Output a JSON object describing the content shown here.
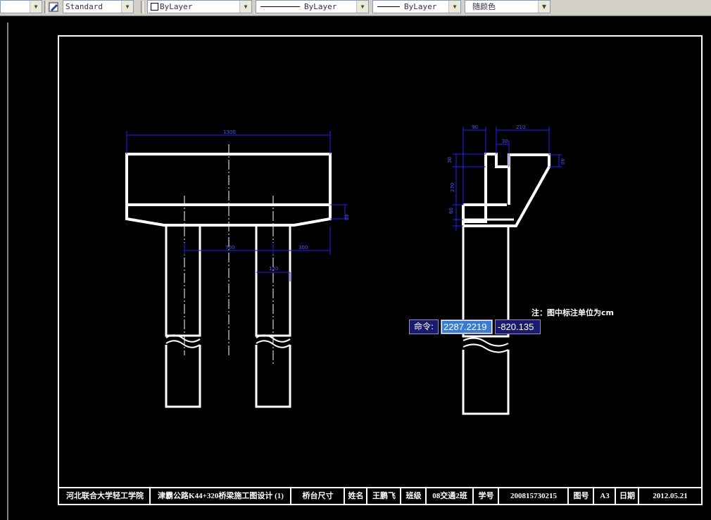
{
  "toolbar": {
    "textstyle_value": "Standard",
    "layer_value": "ByLayer",
    "linetype_value": "ByLayer",
    "lineweight_value": "ByLayer",
    "color_value": "随颜色"
  },
  "dimensions": {
    "front_width": "1300",
    "front_right_height": "40",
    "front_pile_spacing": "700",
    "front_right_offset": "300",
    "front_pile_diameter": "120",
    "side_top_left": "90",
    "side_top_right": "210",
    "side_inner": "30",
    "side_d1": "30",
    "side_d2": "270",
    "side_d3": "60",
    "side_d4": "40"
  },
  "note_text": "注：图中标注单位为cm",
  "command": {
    "label": "命令:",
    "x_value": "2287.2219",
    "y_value": "-820.135"
  },
  "title_block": {
    "school": "河北联合大学轻工学院",
    "project": "津霸公路K44+320桥梁施工图设计 (1)",
    "drawing_name": "桥台尺寸",
    "name_label": "姓名",
    "name_value": "王鹏飞",
    "class_label": "班级",
    "class_value": "08交通2班",
    "id_label": "学号",
    "id_value": "200815730215",
    "sheet_label": "图号",
    "sheet_value": "A3",
    "date_label": "日期",
    "date_value": "2012.05.21"
  },
  "colors": {
    "drawing": "#ffffff",
    "dimension": "#2020ff",
    "background": "#000000",
    "command_bg": "#1b1b6e",
    "highlight": "#3a7bd5"
  }
}
